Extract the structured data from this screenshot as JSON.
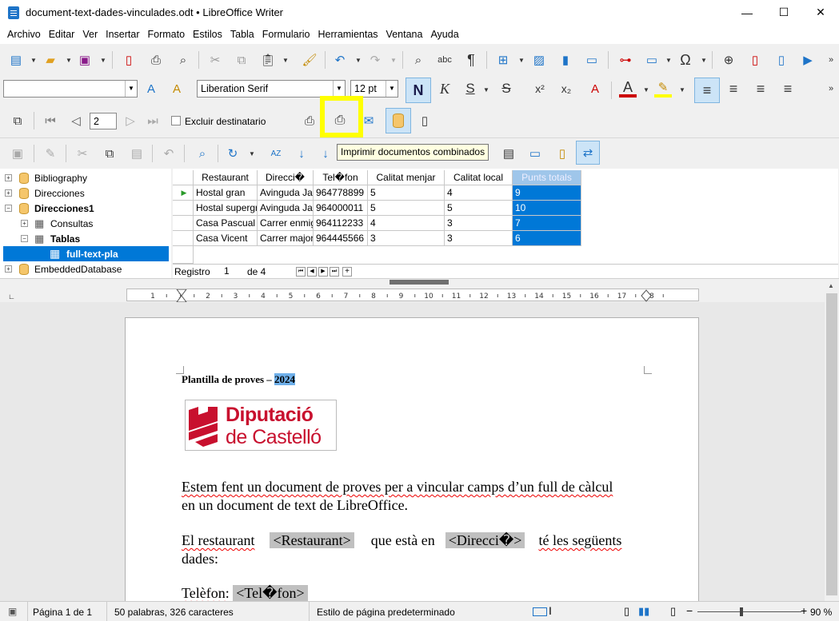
{
  "window": {
    "title": "document-text-dades-vinculades.odt • LibreOffice Writer"
  },
  "menu": [
    "Archivo",
    "Editar",
    "Ver",
    "Insertar",
    "Formato",
    "Estilos",
    "Tabla",
    "Formulario",
    "Herramientas",
    "Ventana",
    "Ayuda"
  ],
  "format_bar": {
    "font_name": "Liberation Serif",
    "font_size": "12 pt",
    "bold": "N",
    "italic": "K",
    "underline": "S",
    "strike": "S",
    "superscript": "x²",
    "subscript": "x₂"
  },
  "mailmerge_bar": {
    "record_value": "2",
    "exclude_label": "Excluir destinatario",
    "tooltip": "Imprimir documentos combinados",
    "highlight_color": "#ffff00"
  },
  "tree": {
    "items": [
      "Bibliography",
      "Direcciones",
      "Direcciones1",
      "Consultas",
      "Tablas",
      "full-text-pla",
      "EmbeddedDatabase"
    ]
  },
  "grid": {
    "headers": [
      "Restaurant",
      "Direcci�",
      "Tel�fon",
      "Calitat menjar",
      "Calitat local",
      "Punts totals"
    ],
    "rows": [
      [
        "Hostal gran",
        "Avinguda Jau",
        "964778899",
        "5",
        "4",
        "9"
      ],
      [
        "Hostal supergr",
        "Avinguda Jau",
        "964000011",
        "5",
        "5",
        "10"
      ],
      [
        "Casa Pascual",
        "Carrer enmig",
        "964112233",
        "4",
        "3",
        "7"
      ],
      [
        "Casa Vicent",
        "Carrer major",
        "964445566",
        "3",
        "3",
        "6"
      ]
    ],
    "nav": {
      "label": "Registro",
      "current": "1",
      "of": "de 4"
    }
  },
  "ruler": {
    "ticks": [
      "1",
      "1",
      "2",
      "3",
      "4",
      "5",
      "6",
      "7",
      "8",
      "9",
      "10",
      "11",
      "12",
      "13",
      "14",
      "15",
      "16",
      "17",
      "18"
    ]
  },
  "document": {
    "heading": "Plantilla de proves – ",
    "heading_year": "2024",
    "logo_line1": "Diputació",
    "logo_line2": "de Castelló",
    "para1_line1": "Estem fent un document de proves per a vincular camps d’un full de càlcul",
    "para1_line2": "en un document de text de LibreOffice.",
    "para2_a": "El restaurant",
    "field_restaurant": "<Restaurant>",
    "para2_b": "que està en",
    "field_direccio": "<Direcci�>",
    "para2_c": "té les següents",
    "para2_line2": "dades:",
    "tel_label": "Telèfon:",
    "field_tel": "<Tel�fon>"
  },
  "status": {
    "page": "Página 1 de 1",
    "words": "50 palabras, 326 caracteres",
    "style": "Estilo de página predeterminado",
    "zoom": "90 %"
  }
}
